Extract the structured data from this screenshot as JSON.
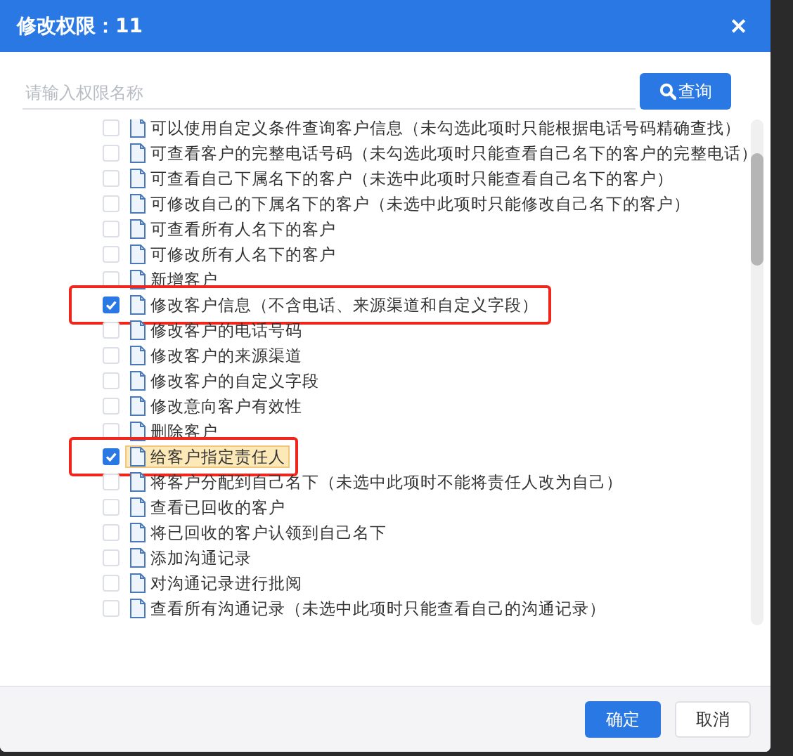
{
  "dialog": {
    "title": "修改权限：11",
    "close": "✕"
  },
  "search": {
    "placeholder": "请输入权限名称",
    "button": "查询"
  },
  "permissions": [
    {
      "label": "可以使用自定义条件查询客户信息（未勾选此项时只能根据电话号码精确查找）",
      "checked": false,
      "highlighted": false,
      "selected": false
    },
    {
      "label": "可查看客户的完整电话号码（未勾选此项时只能查看自己名下的客户的完整电话）",
      "checked": false,
      "highlighted": false,
      "selected": false
    },
    {
      "label": "可查看自己下属名下的客户（未选中此项时只能查看自己名下的客户）",
      "checked": false,
      "highlighted": false,
      "selected": false
    },
    {
      "label": "可修改自己的下属名下的客户（未选中此项时只能修改自己名下的客户）",
      "checked": false,
      "highlighted": false,
      "selected": false
    },
    {
      "label": "可查看所有人名下的客户",
      "checked": false,
      "highlighted": false,
      "selected": false
    },
    {
      "label": "可修改所有人名下的客户",
      "checked": false,
      "highlighted": false,
      "selected": false
    },
    {
      "label": "新增客户",
      "checked": false,
      "highlighted": false,
      "selected": false
    },
    {
      "label": "修改客户信息（不含电话、来源渠道和自定义字段）",
      "checked": true,
      "highlighted": true,
      "selected": false
    },
    {
      "label": "修改客户的电话号码",
      "checked": false,
      "highlighted": false,
      "selected": false
    },
    {
      "label": "修改客户的来源渠道",
      "checked": false,
      "highlighted": false,
      "selected": false
    },
    {
      "label": "修改客户的自定义字段",
      "checked": false,
      "highlighted": false,
      "selected": false
    },
    {
      "label": "修改意向客户有效性",
      "checked": false,
      "highlighted": false,
      "selected": false
    },
    {
      "label": "删除客户",
      "checked": false,
      "highlighted": false,
      "selected": false
    },
    {
      "label": "给客户指定责任人",
      "checked": true,
      "highlighted": true,
      "selected": true
    },
    {
      "label": "将客户分配到自己名下（未选中此项时不能将责任人改为自己）",
      "checked": false,
      "highlighted": false,
      "selected": false
    },
    {
      "label": "查看已回收的客户",
      "checked": false,
      "highlighted": false,
      "selected": false
    },
    {
      "label": "将已回收的客户认领到自己名下",
      "checked": false,
      "highlighted": false,
      "selected": false
    },
    {
      "label": "添加沟通记录",
      "checked": false,
      "highlighted": false,
      "selected": false
    },
    {
      "label": "对沟通记录进行批阅",
      "checked": false,
      "highlighted": false,
      "selected": false
    },
    {
      "label": "查看所有沟通记录（未选中此项时只能查看自己的沟通记录）",
      "checked": false,
      "highlighted": false,
      "selected": false
    }
  ],
  "buttons": {
    "confirm": "确定",
    "cancel": "取消"
  }
}
